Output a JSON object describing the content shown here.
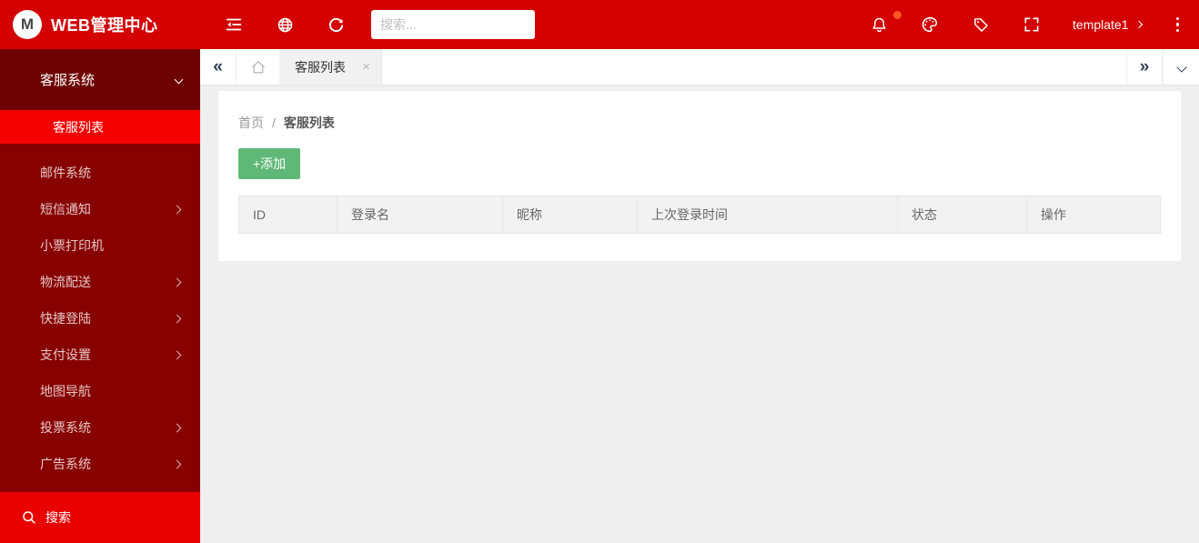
{
  "header": {
    "logo": {
      "initial": "M",
      "title": "WEB管理中心"
    },
    "left_icons": [
      "menu-fold-icon",
      "globe-icon",
      "refresh-icon"
    ],
    "search": {
      "placeholder": "搜索..."
    },
    "right_icons": [
      "bell-icon",
      "palette-icon",
      "tag-icon",
      "fullscreen-icon",
      "more-vertical-icon"
    ],
    "notification_dot_color": "#ff5722",
    "template_switcher": {
      "label": "template1"
    }
  },
  "sidebar": {
    "expanded_parent": {
      "label": "客服系统"
    },
    "active_child": {
      "label": "客服列表"
    },
    "items": [
      {
        "label": "邮件系统",
        "has_arrow": false
      },
      {
        "label": "短信通知",
        "has_arrow": true
      },
      {
        "label": "小票打印机",
        "has_arrow": false
      },
      {
        "label": "物流配送",
        "has_arrow": true
      },
      {
        "label": "快捷登陆",
        "has_arrow": true
      },
      {
        "label": "支付设置",
        "has_arrow": true
      },
      {
        "label": "地图导航",
        "has_arrow": false
      },
      {
        "label": "投票系统",
        "has_arrow": true
      },
      {
        "label": "广告系统",
        "has_arrow": true
      }
    ],
    "search_label": "搜索"
  },
  "tabbar": {
    "collapse_left_glyph": "«",
    "expand_right_glyph": "»",
    "active_tab": {
      "label": "客服列表",
      "close_glyph": "×"
    }
  },
  "breadcrumb": {
    "home": "首页",
    "separator": "/",
    "current": "客服列表"
  },
  "main": {
    "add_button_label": "+添加",
    "table": {
      "columns": [
        "ID",
        "登录名",
        "昵称",
        "上次登录时间",
        "状态",
        "操作"
      ],
      "rows": []
    }
  },
  "colors": {
    "topbar_red": "#d30101",
    "sidebar_red": "#880101",
    "sidebar_expanded_red": "#6e0101",
    "active_item_red": "#f40101",
    "sidebar_search_red": "#e90101",
    "button_green": "#5fb878",
    "notification_orange": "#ff5722"
  }
}
